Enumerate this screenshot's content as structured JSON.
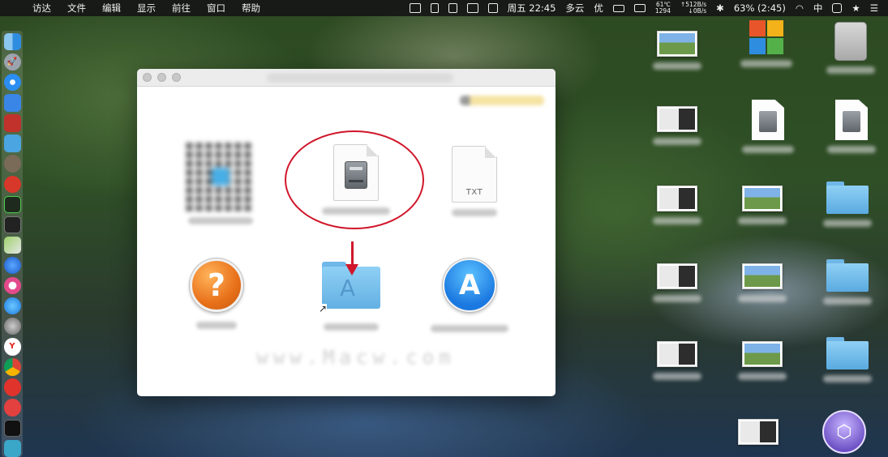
{
  "menubar": {
    "menus": [
      "访达",
      "文件",
      "编辑",
      "显示",
      "前往",
      "窗口",
      "帮助"
    ],
    "temp": "61℃",
    "fan": "1294",
    "net_up": "↑512B/s",
    "net_down": "↓0B/s",
    "datetime": "周五 22:45",
    "weather": "多云",
    "you": "优",
    "battery": "63% (2:45)",
    "input_method": "中"
  },
  "window": {
    "items": {
      "doc_label": "TXT"
    }
  },
  "colors": {
    "annotation": "#d0162a",
    "folder": "#78c2ef",
    "help": "#e8701a",
    "appstore": "#1a78e0"
  },
  "dock": {
    "icons": [
      "finder-icon",
      "launchpad-icon",
      "safari-icon",
      "contacts-icon",
      "dictionary-icon",
      "migration-icon",
      "network-icon",
      "app-icon",
      "activity-monitor-icon",
      "terminal-icon",
      "preview-icon",
      "siri-icon",
      "itunes-icon",
      "app-store-icon",
      "system-preferences-icon",
      "yandex-icon",
      "chrome-icon",
      "netease-music-icon",
      "vivaldi-icon",
      "terminal-icon-2",
      "app-icon-2"
    ]
  }
}
